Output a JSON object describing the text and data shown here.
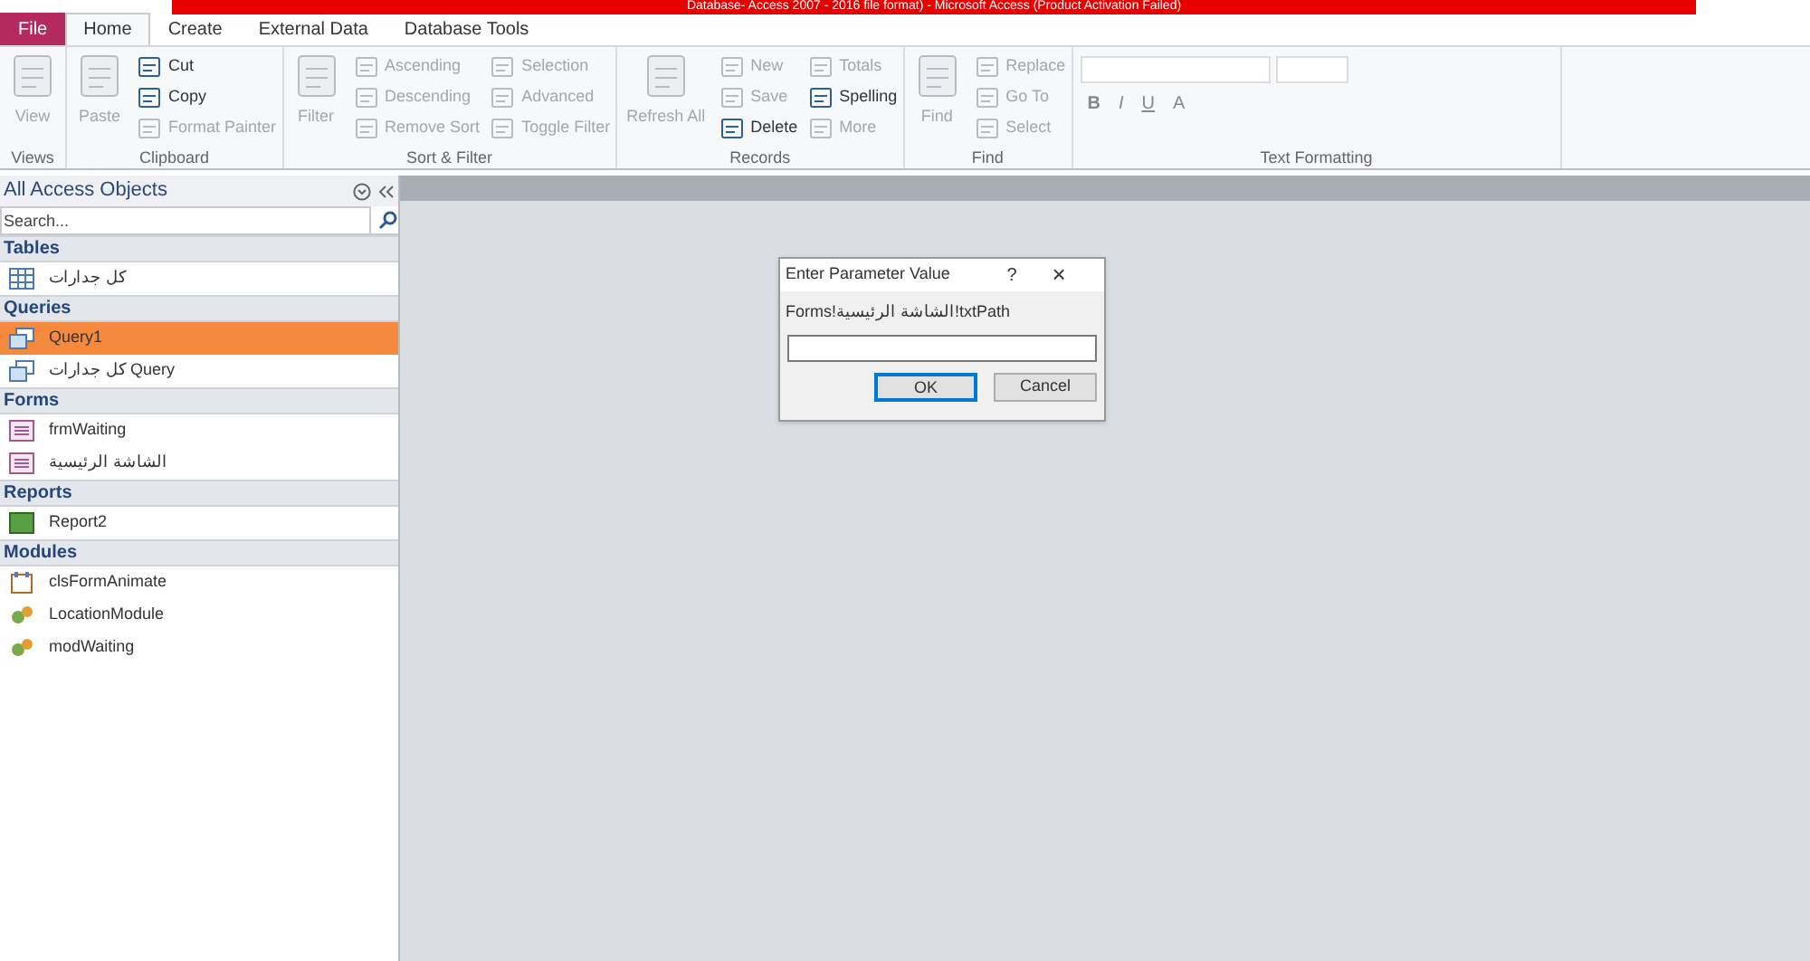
{
  "title_bar": {
    "title": "Database- Access 2007 - 2016 file format) - Microsoft Access (Product Activation Failed)"
  },
  "ribbon_tabs": [
    {
      "label": "File",
      "kind": "file",
      "selected": false
    },
    {
      "label": "Home",
      "kind": "tab",
      "selected": true
    },
    {
      "label": "Create",
      "kind": "tab",
      "selected": false
    },
    {
      "label": "External Data",
      "kind": "tab",
      "selected": false
    },
    {
      "label": "Database Tools",
      "kind": "tab",
      "selected": false
    }
  ],
  "ribbon_groups": [
    {
      "label": "Views",
      "columns": [
        [
          {
            "label": "View",
            "kind": "large",
            "disabled": true
          }
        ]
      ]
    },
    {
      "label": "Clipboard",
      "columns": [
        [
          {
            "label": "Paste",
            "kind": "large",
            "disabled": true
          }
        ],
        [
          {
            "label": "Cut",
            "kind": "small",
            "disabled": false
          },
          {
            "label": "Copy",
            "kind": "small",
            "disabled": false
          },
          {
            "label": "Format Painter",
            "kind": "small",
            "disabled": true
          }
        ]
      ]
    },
    {
      "label": "Sort & Filter",
      "columns": [
        [
          {
            "label": "Filter",
            "kind": "large",
            "disabled": true
          }
        ],
        [
          {
            "label": "Ascending",
            "kind": "small",
            "disabled": true
          },
          {
            "label": "Descending",
            "kind": "small",
            "disabled": true
          },
          {
            "label": "Remove Sort",
            "kind": "small",
            "disabled": true
          }
        ],
        [
          {
            "label": "Selection",
            "kind": "small",
            "disabled": true
          },
          {
            "label": "Advanced",
            "kind": "small",
            "disabled": true
          },
          {
            "label": "Toggle Filter",
            "kind": "small",
            "disabled": true
          }
        ]
      ]
    },
    {
      "label": "Records",
      "columns": [
        [
          {
            "label": "Refresh All",
            "kind": "large",
            "disabled": true
          }
        ],
        [
          {
            "label": "New",
            "kind": "small",
            "disabled": true
          },
          {
            "label": "Save",
            "kind": "small",
            "disabled": true
          },
          {
            "label": "Delete",
            "kind": "small",
            "disabled": false
          }
        ],
        [
          {
            "label": "Totals",
            "kind": "small",
            "disabled": true
          },
          {
            "label": "Spelling",
            "kind": "small",
            "disabled": false
          },
          {
            "label": "More",
            "kind": "small",
            "disabled": true
          }
        ]
      ]
    },
    {
      "label": "Find",
      "columns": [
        [
          {
            "label": "Find",
            "kind": "large",
            "disabled": true
          }
        ],
        [
          {
            "label": "Replace",
            "kind": "small",
            "disabled": true
          },
          {
            "label": "Go To",
            "kind": "small",
            "disabled": true
          },
          {
            "label": "Select",
            "kind": "small",
            "disabled": true
          }
        ]
      ]
    }
  ],
  "text_formatting": {
    "label": "Text Formatting",
    "buttons": [
      "B",
      "I",
      "U",
      "A"
    ]
  },
  "nav_pane": {
    "title": "All Access Objects",
    "search_placeholder": "Search...",
    "sections": [
      {
        "label": "Tables",
        "items": [
          {
            "label": "كل جدارات",
            "kind": "table",
            "selected": false
          }
        ]
      },
      {
        "label": "Queries",
        "items": [
          {
            "label": "Query1",
            "kind": "query",
            "selected": true
          },
          {
            "label": "كل جدارات Query",
            "kind": "query",
            "selected": false
          }
        ]
      },
      {
        "label": "Forms",
        "items": [
          {
            "label": "frmWaiting",
            "kind": "form",
            "selected": false
          },
          {
            "label": "الشاشة الرئيسية",
            "kind": "form",
            "selected": false
          }
        ]
      },
      {
        "label": "Reports",
        "items": [
          {
            "label": "Report2",
            "kind": "report",
            "selected": false
          }
        ]
      },
      {
        "label": "Modules",
        "items": [
          {
            "label": "clsFormAnimate",
            "kind": "module",
            "selected": false
          },
          {
            "label": "LocationModule",
            "kind": "module2",
            "selected": false
          },
          {
            "label": "modWaiting",
            "kind": "module2",
            "selected": false
          }
        ]
      }
    ]
  },
  "dialog": {
    "title": "Enter Parameter Value",
    "help": "?",
    "close": "×",
    "prompt": "Forms!الشاشة الرئيسية!txtPath",
    "buttons": [
      {
        "label": "OK",
        "selected": true
      },
      {
        "label": "Cancel",
        "selected": false
      }
    ]
  }
}
